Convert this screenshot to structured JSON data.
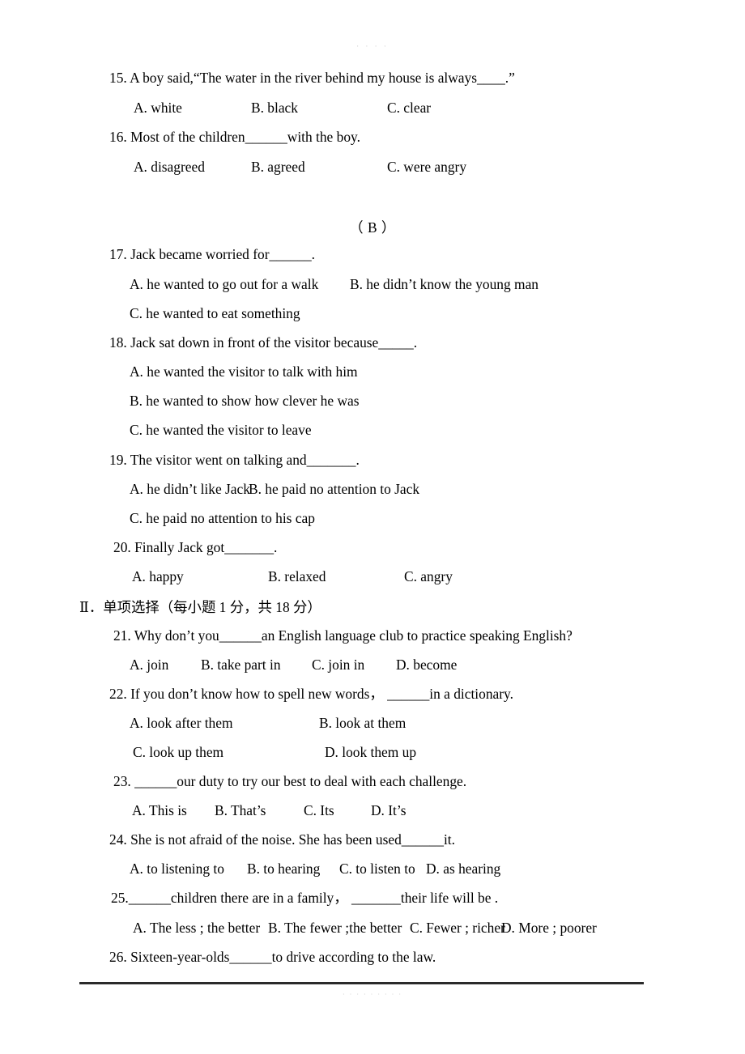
{
  "page": {
    "top_mark": "· · · ·",
    "bottom_mark": "· · · · · · · · ·"
  },
  "reading_section_a": {
    "questions": [
      {
        "number": "15.",
        "stem": "15. A boy said,“The water in the river behind my house is always____.”",
        "options": [
          "A. white",
          "B. black",
          "C. clear"
        ]
      },
      {
        "number": "16.",
        "stem": "16. Most of the children______with the boy.",
        "options": [
          "A. disagreed",
          "B. agreed",
          "C. were angry"
        ]
      }
    ]
  },
  "reading_section_b": {
    "label": "（ B ）",
    "questions": [
      {
        "number": "17.",
        "stem": "17. Jack became worried for______.",
        "option_a": "A. he wanted to go out for a walk",
        "option_b": "B. he didn’t know the young man",
        "option_c": "C. he wanted to eat something"
      },
      {
        "number": "18.",
        "stem": "18. Jack sat down in front of the visitor because_____.",
        "option_a": "A. he wanted the visitor to talk with him",
        "option_b": "B. he wanted to show how clever he was",
        "option_c": "C. he wanted the visitor to leave"
      },
      {
        "number": "19.",
        "stem": "19. The visitor went on talking and_______.",
        "option_a": "A. he didn’t like Jack",
        "option_b": "B. he paid no attention to Jack",
        "option_c": "C. he paid no attention to his cap"
      },
      {
        "number": "20.",
        "stem": "20. Finally Jack got_______.",
        "options": [
          "A. happy",
          "B. relaxed",
          "C. angry"
        ]
      }
    ]
  },
  "multiple_choice_section": {
    "heading": "Ⅱ．单项选择（每小题 1 分，共 18 分）",
    "questions": [
      {
        "number": "21.",
        "stem": "21. Why don’t you______an English language club to practice speaking English?",
        "options": [
          "A. join",
          "B. take part in",
          "C. join in",
          "D. become"
        ]
      },
      {
        "number": "22.",
        "stem": "22. If you don’t know how to spell new words，  ______in a dictionary.",
        "option_a": "A. look after them",
        "option_b": "B. look at them",
        "option_c": "C. look up them",
        "option_d": "D. look them up"
      },
      {
        "number": "23.",
        "stem": "23.  ______our duty to try our best to deal with each challenge.",
        "options": [
          "A. This is",
          "B. That’s",
          "C. Its",
          "D. It’s"
        ]
      },
      {
        "number": "24.",
        "stem": "24. She is not afraid of the noise. She has been used______it.",
        "options": [
          "A. to listening to",
          "B. to hearing",
          "C. to listen to",
          "D. as hearing"
        ]
      },
      {
        "number": "25.",
        "stem": "25.______children there are in a family，  _______their life will be .",
        "options": [
          "A. The less ; the better",
          "B. The fewer ;the better",
          "C. Fewer ; richer",
          "D. More ; poorer"
        ]
      },
      {
        "number": "26.",
        "stem": "26. Sixteen-year-olds______to drive according to the law."
      }
    ]
  }
}
